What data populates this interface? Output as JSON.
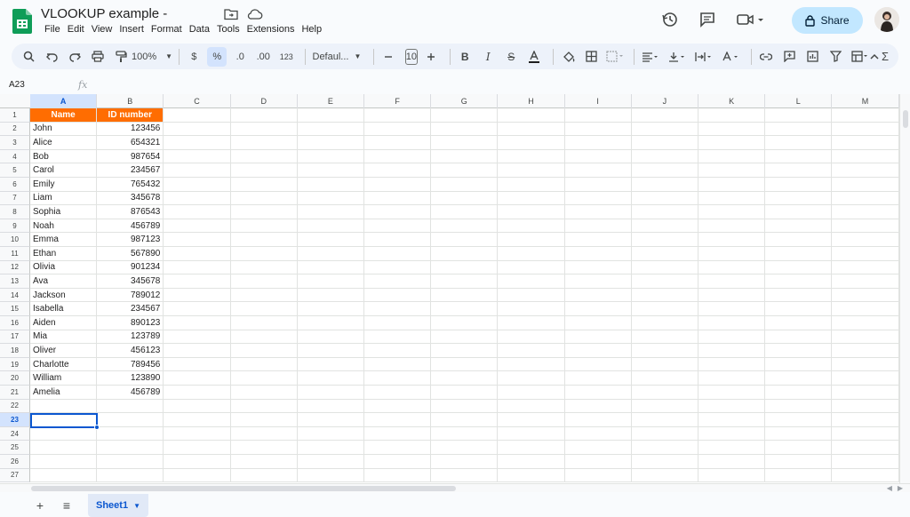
{
  "app": {
    "doc_title": "VLOOKUP example -",
    "brand_color": "#0f9d58"
  },
  "menu": [
    "File",
    "Edit",
    "View",
    "Insert",
    "Format",
    "Data",
    "Tools",
    "Extensions",
    "Help"
  ],
  "header_actions": {
    "share_label": "Share"
  },
  "toolbar": {
    "zoom": "100%",
    "currency": "$",
    "percent": "%",
    "decimal_decrease": ".0",
    "decimal_increase": ".00",
    "number_format": "123",
    "font": "Defaul...",
    "font_size": "10"
  },
  "formula_bar": {
    "name_box": "A23",
    "fx": "fx",
    "value": ""
  },
  "grid": {
    "columns": [
      "A",
      "B",
      "C",
      "D",
      "E",
      "F",
      "G",
      "H",
      "I",
      "J",
      "K",
      "L",
      "M"
    ],
    "selected_column": "A",
    "selected_row": 23,
    "header_color": "#ff6d01",
    "rows": [
      [
        "Name",
        "ID number"
      ],
      [
        "John",
        "123456"
      ],
      [
        "Alice",
        "654321"
      ],
      [
        "Bob",
        "987654"
      ],
      [
        "Carol",
        "234567"
      ],
      [
        "Emily",
        "765432"
      ],
      [
        "Liam",
        "345678"
      ],
      [
        "Sophia",
        "876543"
      ],
      [
        "Noah",
        "456789"
      ],
      [
        "Emma",
        "987123"
      ],
      [
        "Ethan",
        "567890"
      ],
      [
        "Olivia",
        "901234"
      ],
      [
        "Ava",
        "345678"
      ],
      [
        "Jackson",
        "789012"
      ],
      [
        "Isabella",
        "234567"
      ],
      [
        "Aiden",
        "890123"
      ],
      [
        "Mia",
        "123789"
      ],
      [
        "Oliver",
        "456123"
      ],
      [
        "Charlotte",
        "789456"
      ],
      [
        "William",
        "123890"
      ],
      [
        "Amelia",
        "456789"
      ],
      [
        "",
        ""
      ],
      [
        "",
        ""
      ],
      [
        "",
        ""
      ],
      [
        "",
        ""
      ],
      [
        "",
        ""
      ],
      [
        "",
        ""
      ]
    ]
  },
  "sheets": {
    "tabs": [
      "Sheet1"
    ],
    "add": "+",
    "all_sheets": "≡"
  }
}
